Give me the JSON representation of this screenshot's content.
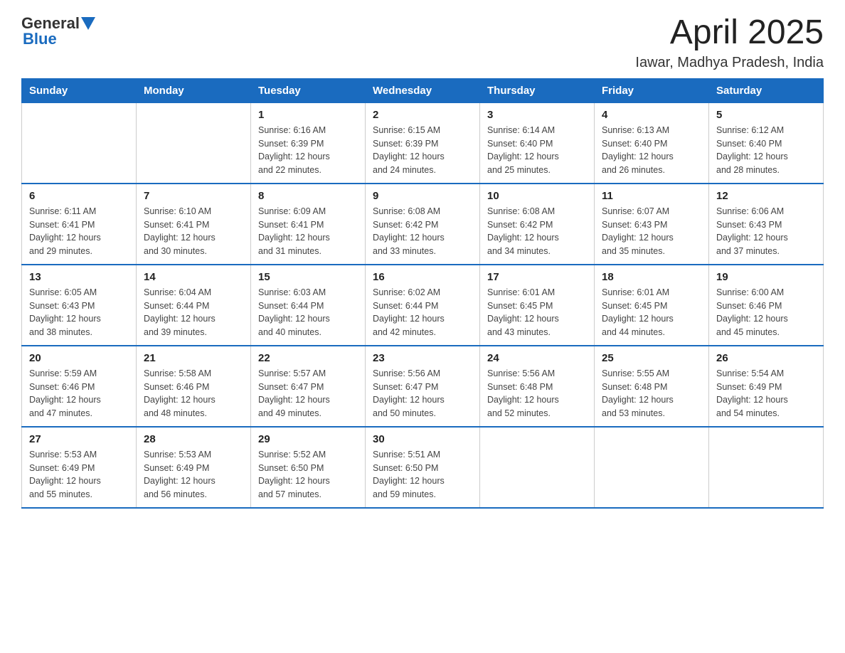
{
  "logo": {
    "general": "General",
    "blue": "Blue"
  },
  "header": {
    "title": "April 2025",
    "subtitle": "Iawar, Madhya Pradesh, India"
  },
  "days_of_week": [
    "Sunday",
    "Monday",
    "Tuesday",
    "Wednesday",
    "Thursday",
    "Friday",
    "Saturday"
  ],
  "weeks": [
    [
      {
        "day": "",
        "info": ""
      },
      {
        "day": "",
        "info": ""
      },
      {
        "day": "1",
        "info": "Sunrise: 6:16 AM\nSunset: 6:39 PM\nDaylight: 12 hours\nand 22 minutes."
      },
      {
        "day": "2",
        "info": "Sunrise: 6:15 AM\nSunset: 6:39 PM\nDaylight: 12 hours\nand 24 minutes."
      },
      {
        "day": "3",
        "info": "Sunrise: 6:14 AM\nSunset: 6:40 PM\nDaylight: 12 hours\nand 25 minutes."
      },
      {
        "day": "4",
        "info": "Sunrise: 6:13 AM\nSunset: 6:40 PM\nDaylight: 12 hours\nand 26 minutes."
      },
      {
        "day": "5",
        "info": "Sunrise: 6:12 AM\nSunset: 6:40 PM\nDaylight: 12 hours\nand 28 minutes."
      }
    ],
    [
      {
        "day": "6",
        "info": "Sunrise: 6:11 AM\nSunset: 6:41 PM\nDaylight: 12 hours\nand 29 minutes."
      },
      {
        "day": "7",
        "info": "Sunrise: 6:10 AM\nSunset: 6:41 PM\nDaylight: 12 hours\nand 30 minutes."
      },
      {
        "day": "8",
        "info": "Sunrise: 6:09 AM\nSunset: 6:41 PM\nDaylight: 12 hours\nand 31 minutes."
      },
      {
        "day": "9",
        "info": "Sunrise: 6:08 AM\nSunset: 6:42 PM\nDaylight: 12 hours\nand 33 minutes."
      },
      {
        "day": "10",
        "info": "Sunrise: 6:08 AM\nSunset: 6:42 PM\nDaylight: 12 hours\nand 34 minutes."
      },
      {
        "day": "11",
        "info": "Sunrise: 6:07 AM\nSunset: 6:43 PM\nDaylight: 12 hours\nand 35 minutes."
      },
      {
        "day": "12",
        "info": "Sunrise: 6:06 AM\nSunset: 6:43 PM\nDaylight: 12 hours\nand 37 minutes."
      }
    ],
    [
      {
        "day": "13",
        "info": "Sunrise: 6:05 AM\nSunset: 6:43 PM\nDaylight: 12 hours\nand 38 minutes."
      },
      {
        "day": "14",
        "info": "Sunrise: 6:04 AM\nSunset: 6:44 PM\nDaylight: 12 hours\nand 39 minutes."
      },
      {
        "day": "15",
        "info": "Sunrise: 6:03 AM\nSunset: 6:44 PM\nDaylight: 12 hours\nand 40 minutes."
      },
      {
        "day": "16",
        "info": "Sunrise: 6:02 AM\nSunset: 6:44 PM\nDaylight: 12 hours\nand 42 minutes."
      },
      {
        "day": "17",
        "info": "Sunrise: 6:01 AM\nSunset: 6:45 PM\nDaylight: 12 hours\nand 43 minutes."
      },
      {
        "day": "18",
        "info": "Sunrise: 6:01 AM\nSunset: 6:45 PM\nDaylight: 12 hours\nand 44 minutes."
      },
      {
        "day": "19",
        "info": "Sunrise: 6:00 AM\nSunset: 6:46 PM\nDaylight: 12 hours\nand 45 minutes."
      }
    ],
    [
      {
        "day": "20",
        "info": "Sunrise: 5:59 AM\nSunset: 6:46 PM\nDaylight: 12 hours\nand 47 minutes."
      },
      {
        "day": "21",
        "info": "Sunrise: 5:58 AM\nSunset: 6:46 PM\nDaylight: 12 hours\nand 48 minutes."
      },
      {
        "day": "22",
        "info": "Sunrise: 5:57 AM\nSunset: 6:47 PM\nDaylight: 12 hours\nand 49 minutes."
      },
      {
        "day": "23",
        "info": "Sunrise: 5:56 AM\nSunset: 6:47 PM\nDaylight: 12 hours\nand 50 minutes."
      },
      {
        "day": "24",
        "info": "Sunrise: 5:56 AM\nSunset: 6:48 PM\nDaylight: 12 hours\nand 52 minutes."
      },
      {
        "day": "25",
        "info": "Sunrise: 5:55 AM\nSunset: 6:48 PM\nDaylight: 12 hours\nand 53 minutes."
      },
      {
        "day": "26",
        "info": "Sunrise: 5:54 AM\nSunset: 6:49 PM\nDaylight: 12 hours\nand 54 minutes."
      }
    ],
    [
      {
        "day": "27",
        "info": "Sunrise: 5:53 AM\nSunset: 6:49 PM\nDaylight: 12 hours\nand 55 minutes."
      },
      {
        "day": "28",
        "info": "Sunrise: 5:53 AM\nSunset: 6:49 PM\nDaylight: 12 hours\nand 56 minutes."
      },
      {
        "day": "29",
        "info": "Sunrise: 5:52 AM\nSunset: 6:50 PM\nDaylight: 12 hours\nand 57 minutes."
      },
      {
        "day": "30",
        "info": "Sunrise: 5:51 AM\nSunset: 6:50 PM\nDaylight: 12 hours\nand 59 minutes."
      },
      {
        "day": "",
        "info": ""
      },
      {
        "day": "",
        "info": ""
      },
      {
        "day": "",
        "info": ""
      }
    ]
  ]
}
